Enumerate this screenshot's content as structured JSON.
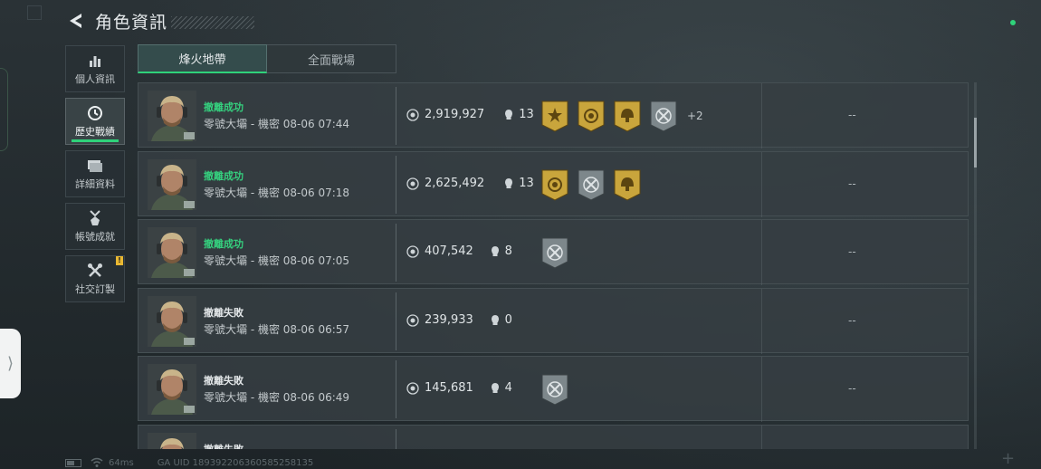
{
  "header": {
    "title": "角色資訊"
  },
  "sidebar": {
    "items": [
      {
        "label": "個人資訊",
        "icon": "bar-chart-icon",
        "active": false
      },
      {
        "label": "歷史戰績",
        "icon": "clock-icon",
        "active": true
      },
      {
        "label": "詳細資料",
        "icon": "folder-icon",
        "active": false
      },
      {
        "label": "帳號成就",
        "icon": "medal-icon",
        "active": false
      },
      {
        "label": "社交訂製",
        "icon": "tools-icon",
        "active": false,
        "badge": "!"
      }
    ]
  },
  "tabs": [
    {
      "label": "烽火地帶",
      "active": true
    },
    {
      "label": "全面戰場",
      "active": false
    }
  ],
  "matches": [
    {
      "status": "撤離成功",
      "result": "success",
      "detail": "零號大壩 - 機密 08-06 07:44",
      "value": "2,919,927",
      "kills": "13",
      "badges": [
        "sun-medal-icon",
        "target-medal-icon",
        "helmet-medal-icon",
        "crossed-arrows-icon"
      ],
      "more": "+2",
      "extra": "--"
    },
    {
      "status": "撤離成功",
      "result": "success",
      "detail": "零號大壩 - 機密 08-06 07:18",
      "value": "2,625,492",
      "kills": "13",
      "badges": [
        "target-medal-icon",
        "crossed-arrows-icon",
        "helmet-medal-icon"
      ],
      "more": "",
      "extra": "--"
    },
    {
      "status": "撤離成功",
      "result": "success",
      "detail": "零號大壩 - 機密 08-06 07:05",
      "value": "407,542",
      "kills": "8",
      "badges": [
        "crossed-arrows-icon"
      ],
      "more": "",
      "extra": "--"
    },
    {
      "status": "撤離失敗",
      "result": "fail",
      "detail": "零號大壩 - 機密 08-06 06:57",
      "value": "239,933",
      "kills": "0",
      "badges": [],
      "more": "",
      "extra": "--"
    },
    {
      "status": "撤離失敗",
      "result": "fail",
      "detail": "零號大壩 - 機密 08-06 06:49",
      "value": "145,681",
      "kills": "4",
      "badges": [
        "crossed-arrows-icon"
      ],
      "more": "",
      "extra": "--"
    },
    {
      "status": "撤離失敗",
      "result": "fail",
      "detail": "",
      "value": "",
      "kills": "",
      "badges": [],
      "more": "",
      "extra": ""
    }
  ],
  "footer": {
    "ping": "64ms",
    "uid": "GA UID 189392206360585258135"
  },
  "colors": {
    "accent": "#2fd27a",
    "success": "#35d07e",
    "gold": "#c9a53c",
    "silver": "#7d878b"
  }
}
